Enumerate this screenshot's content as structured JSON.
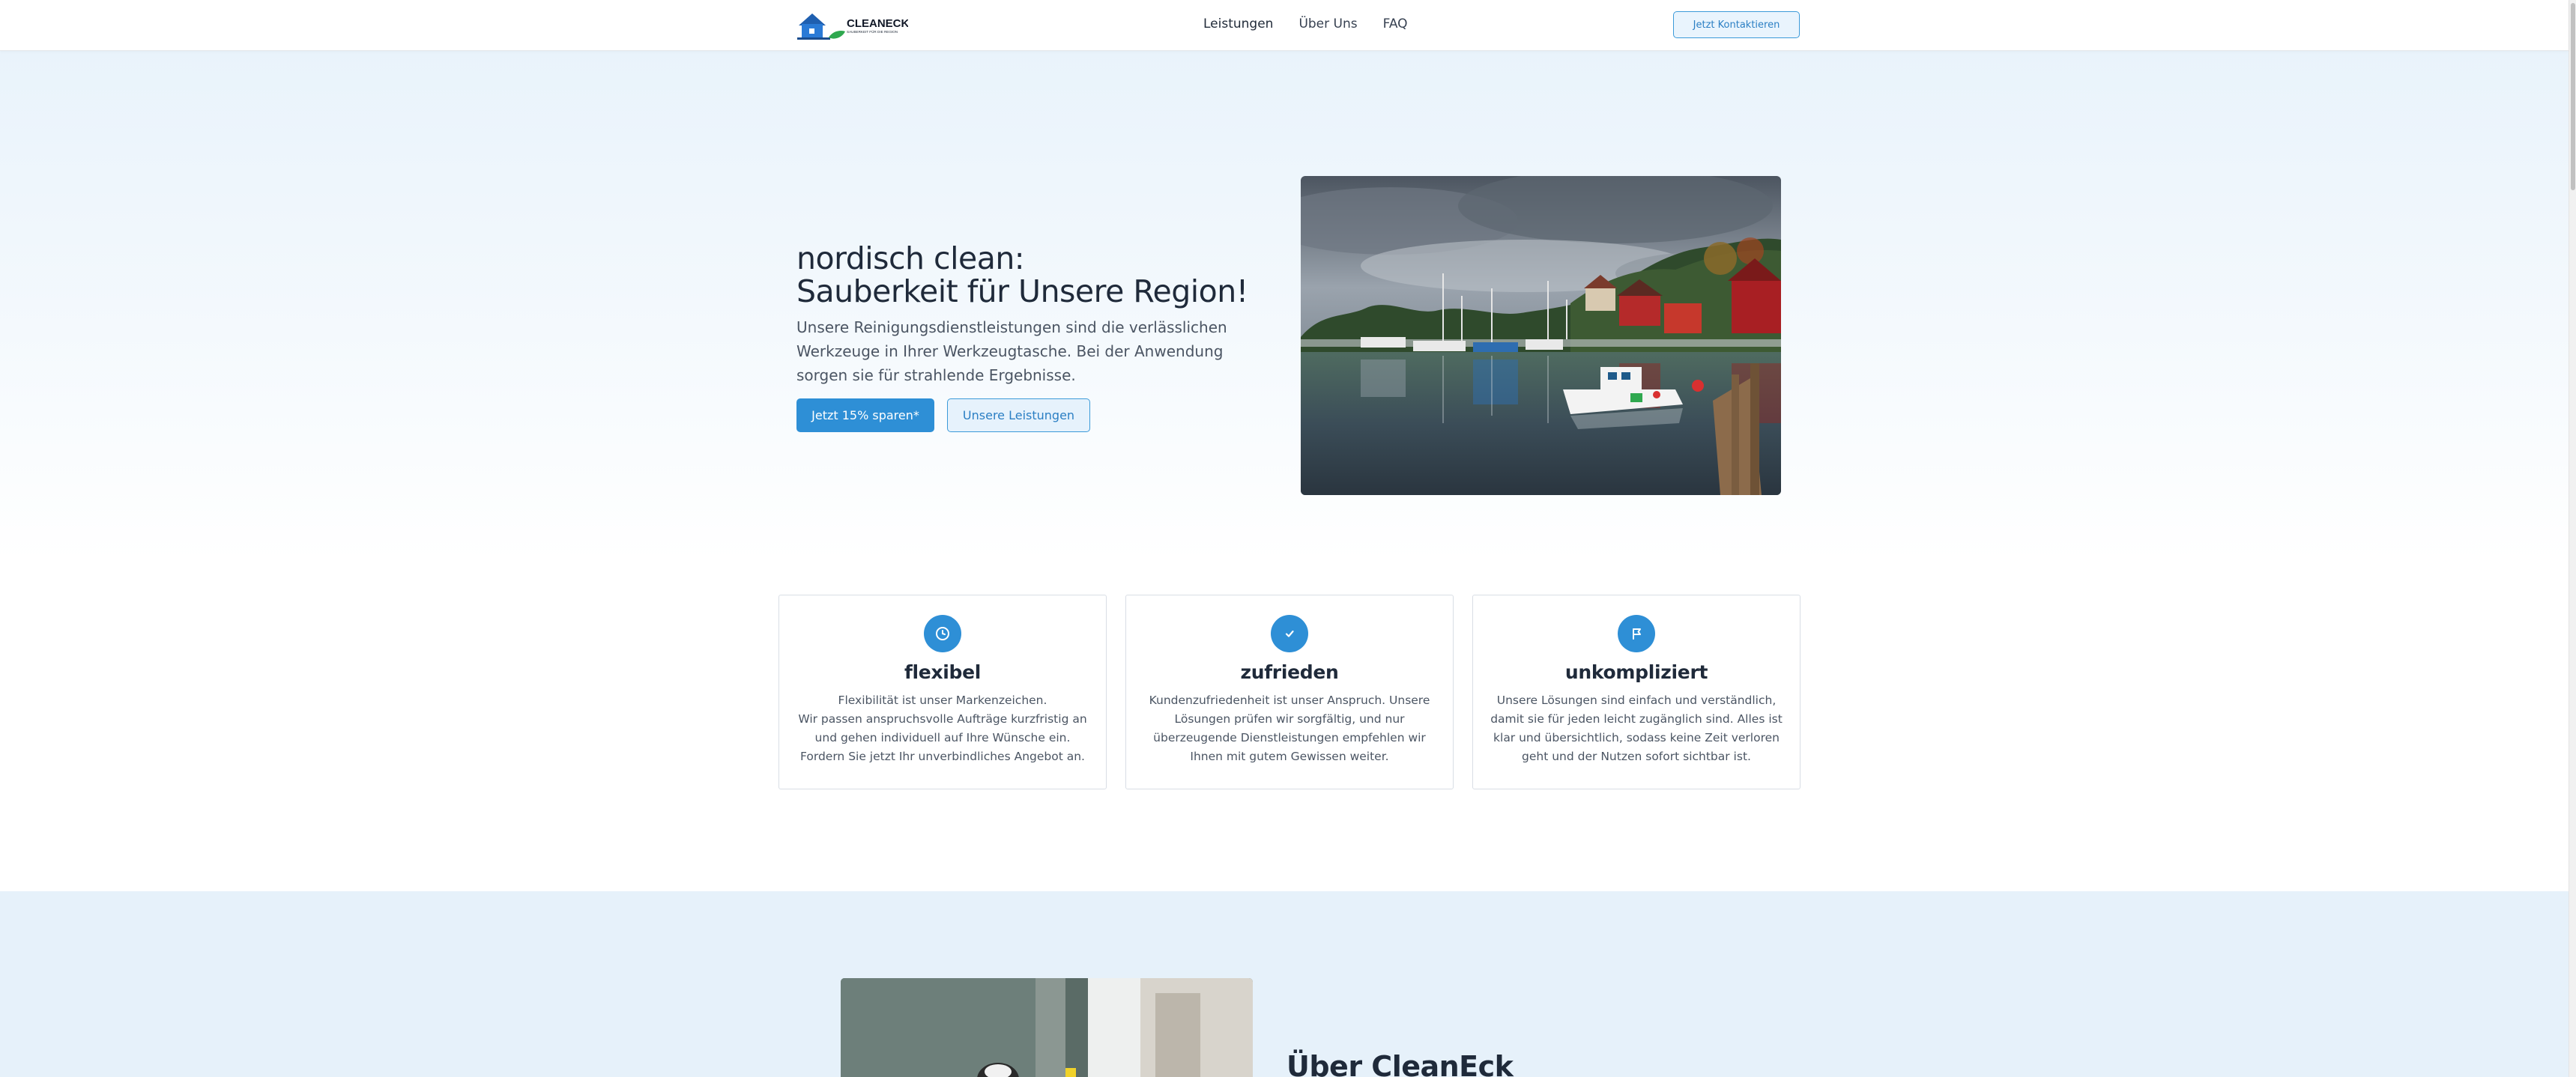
{
  "header": {
    "logo": {
      "text": "CLEANECK",
      "tagline": "SAUBERKEIT FÜR DIE REGION",
      "icon": "house-leaf-logo"
    },
    "nav": [
      {
        "label": "Leistungen"
      },
      {
        "label": "Über Uns"
      },
      {
        "label": "FAQ"
      }
    ],
    "contact_button": "Jetzt Kontaktieren"
  },
  "hero": {
    "title_line1": "nordisch clean:",
    "title_line2": "Sauberkeit für Unsere Region!",
    "text": "Unsere Reinigungsdienstleistungen sind die verlässlichen Werkzeuge in Ihrer Werkzeugtasche. Bei der Anwendung sorgen sie für strahlende Ergebnisse.",
    "primary_button": "Jetzt 15% sparen*",
    "secondary_button": "Unsere Leistungen",
    "image": "harbor-photo"
  },
  "features": [
    {
      "icon": "clock-icon",
      "title": "flexibel",
      "lines": [
        "Flexibilität ist unser Markenzeichen.",
        "Wir passen anspruchsvolle Aufträge kurzfristig an",
        "und gehen individuell auf Ihre Wünsche ein.",
        "Fordern Sie jetzt Ihr unverbindliches Angebot an."
      ]
    },
    {
      "icon": "check-icon",
      "title": "zufrieden",
      "lines": [
        "Kundenzufriedenheit ist unser Anspruch. Unsere",
        "Lösungen prüfen wir sorgfältig, und nur",
        "überzeugende Dienstleistungen empfehlen wir",
        "Ihnen mit gutem Gewissen weiter."
      ]
    },
    {
      "icon": "flag-icon",
      "title": "unkompliziert",
      "lines": [
        "Unsere Lösungen sind einfach und verständlich,",
        "damit sie für jeden leicht zugänglich sind. Alles ist",
        "klar und übersichtlich, sodass keine Zeit verloren",
        "geht und der Nutzen sofort sichtbar ist."
      ]
    }
  ],
  "about": {
    "title": "Über CleanEck",
    "image": "cleaning-photo"
  },
  "colors": {
    "accent": "#2e8fd6",
    "hero_bg": "#e9f3fb",
    "about_bg": "#e6f1fa",
    "heading": "#1f2a3a"
  }
}
